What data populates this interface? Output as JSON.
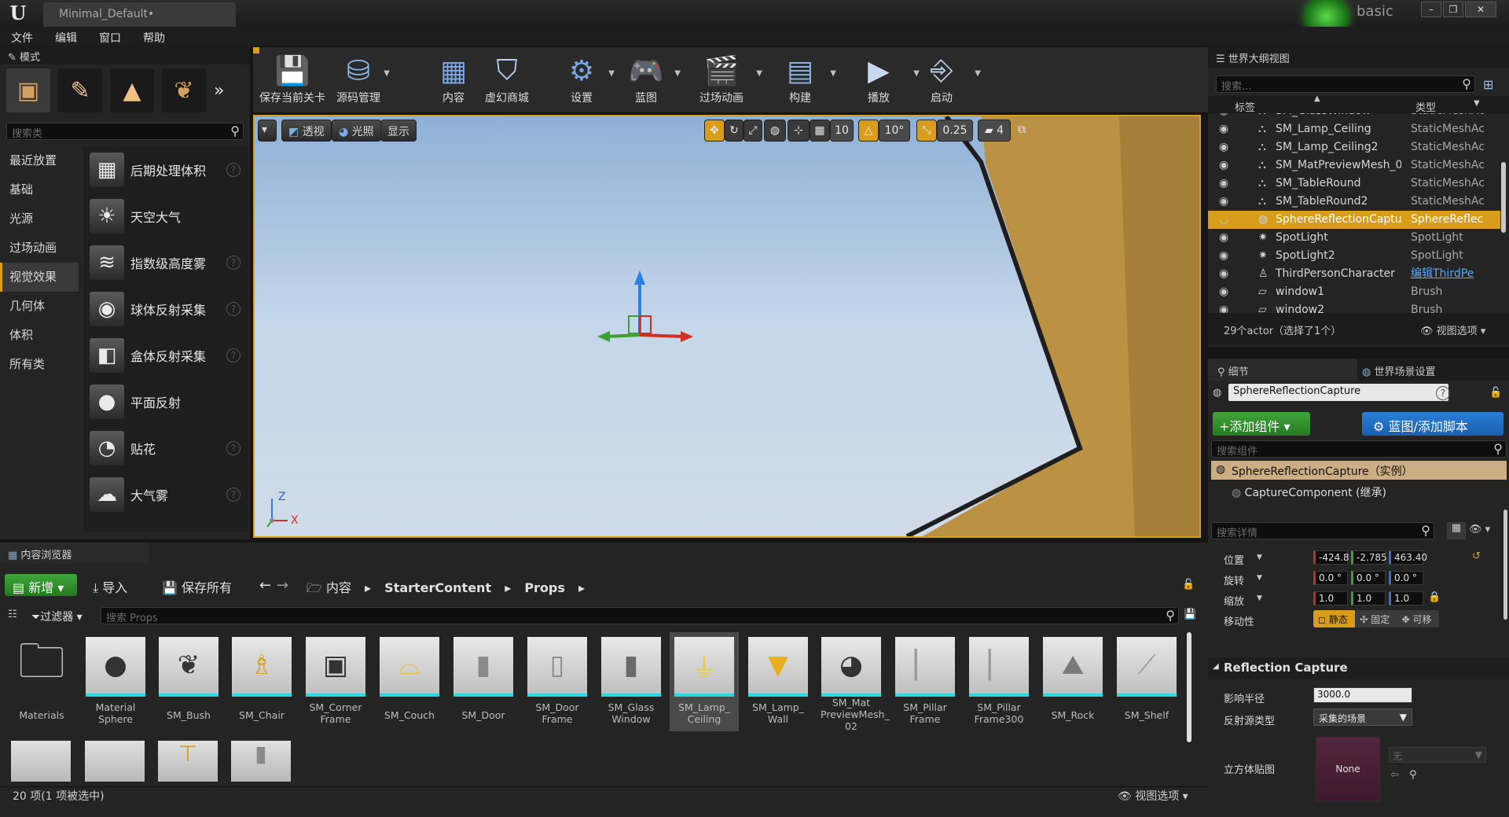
{
  "app": {
    "tab_title": "Minimal_Default•",
    "profile_name": "basic",
    "window_buttons": [
      "–",
      "❐",
      "✕"
    ]
  },
  "menu": [
    "文件",
    "编辑",
    "窗口",
    "帮助"
  ],
  "modes": {
    "tab_label": "模式",
    "search_placeholder": "搜索类",
    "categories": [
      "最近放置",
      "基础",
      "光源",
      "过场动画",
      "视觉效果",
      "几何体",
      "体积",
      "所有类"
    ],
    "active_category": "视觉效果",
    "items": [
      {
        "label": "后期处理体积",
        "icon": "post-process-icon",
        "help": true
      },
      {
        "label": "天空大气",
        "icon": "sky-atmosphere-icon",
        "help": false
      },
      {
        "label": "指数级高度雾",
        "icon": "height-fog-icon",
        "help": true
      },
      {
        "label": "球体反射采集",
        "icon": "sphere-reflection-icon",
        "help": true
      },
      {
        "label": "盒体反射采集",
        "icon": "box-reflection-icon",
        "help": true
      },
      {
        "label": "平面反射",
        "icon": "planar-reflection-icon",
        "help": false
      },
      {
        "label": "贴花",
        "icon": "decal-icon",
        "help": true
      },
      {
        "label": "大气雾",
        "icon": "atmospheric-fog-icon",
        "help": true
      }
    ]
  },
  "toolbar": {
    "save": "保存当前关卡",
    "source_control": "源码管理",
    "content": "内容",
    "marketplace": "虚幻商城",
    "settings": "设置",
    "blueprints": "蓝图",
    "cinematics": "过场动画",
    "build": "构建",
    "play": "播放",
    "launch": "启动"
  },
  "viewport": {
    "perspective": "透视",
    "lit": "光照",
    "show": "显示",
    "grid_snap": "10",
    "rotation_snap": "10°",
    "scale_snap": "0.25",
    "camera_speed": "4",
    "axis_z": "Z",
    "axis_x": "X",
    "sky_color": "#b7cde6",
    "wall_color": "#c8a052"
  },
  "outliner": {
    "tab_label": "世界大纲视图",
    "search_placeholder": "搜索...",
    "col_label": "标签",
    "col_type": "类型",
    "rows": [
      {
        "name": "SM_GlassWindow",
        "type": "StaticMeshAc"
      },
      {
        "name": "SM_Lamp_Ceiling",
        "type": "StaticMeshAc"
      },
      {
        "name": "SM_Lamp_Ceiling2",
        "type": "StaticMeshAc"
      },
      {
        "name": "SM_MatPreviewMesh_0",
        "type": "StaticMeshAc"
      },
      {
        "name": "SM_TableRound",
        "type": "StaticMeshAc"
      },
      {
        "name": "SM_TableRound2",
        "type": "StaticMeshAc"
      },
      {
        "name": "SphereReflectionCapture",
        "type": "SphereReflec"
      },
      {
        "name": "SpotLight",
        "type": "SpotLight"
      },
      {
        "name": "SpotLight2",
        "type": "SpotLight"
      },
      {
        "name": "ThirdPersonCharacter",
        "type": "编辑ThirdPe"
      },
      {
        "name": "window1",
        "type": "Brush"
      },
      {
        "name": "window2",
        "type": "Brush"
      }
    ],
    "selected_index": 6,
    "status": "29个actor（选择了1个）",
    "view_options": "视图选项"
  },
  "details": {
    "tab_details": "细节",
    "tab_world": "世界场景设置",
    "actor_name": "SphereReflectionCapture",
    "add_component": "+添加组件",
    "blueprint_script": "蓝图/添加脚本",
    "search_components": "搜索组件",
    "instance_label": "SphereReflectionCapture（实例）",
    "component_label": "CaptureComponent (继承)",
    "search_details": "搜索详情",
    "location_label": "位置",
    "location": [
      "-424.8",
      "-2.785",
      "463.40"
    ],
    "rotation_label": "旋转",
    "rotation": [
      "0.0 °",
      "0.0 °",
      "0.0 °"
    ],
    "scale_label": "缩放",
    "scale": [
      "1.0",
      "1.0",
      "1.0"
    ],
    "mobility_label": "移动性",
    "mobility": [
      "静态",
      "固定",
      "可移"
    ],
    "section_title": "Reflection Capture",
    "radius_label": "影响半径",
    "radius_value": "3000.0",
    "source_type_label": "反射源类型",
    "source_type_value": "采集的场景",
    "cubemap_label": "立方体贴图",
    "cubemap_value": "None",
    "cubemap_none": "无"
  },
  "content_browser": {
    "tab_label": "内容浏览器",
    "new_label": "新增",
    "import_label": "导入",
    "save_all_label": "保存所有",
    "path": [
      "内容",
      "StarterContent",
      "Props"
    ],
    "filters_label": "过滤器",
    "search_placeholder": "搜索 Props",
    "status": "20 项(1 项被选中)",
    "view_options": "视图选项",
    "assets": [
      {
        "line1": "Materials",
        "line2": "",
        "line3": "",
        "icon": "folder-icon",
        "kind": "folder"
      },
      {
        "line1": "Material",
        "line2": "Sphere",
        "line3": "",
        "icon": "sphere-icon"
      },
      {
        "line1": "SM_Bush",
        "line2": "",
        "line3": "",
        "icon": "bush-icon"
      },
      {
        "line1": "SM_Chair",
        "line2": "",
        "line3": "",
        "icon": "chair-icon"
      },
      {
        "line1": "SM_Corner",
        "line2": "Frame",
        "line3": "",
        "icon": "frame-icon"
      },
      {
        "line1": "SM_Couch",
        "line2": "",
        "line3": "",
        "icon": "couch-icon"
      },
      {
        "line1": "SM_Door",
        "line2": "",
        "line3": "",
        "icon": "door-icon"
      },
      {
        "line1": "SM_Door",
        "line2": "Frame",
        "line3": "",
        "icon": "door-frame-icon"
      },
      {
        "line1": "SM_Glass",
        "line2": "Window",
        "line3": "",
        "icon": "window-icon"
      },
      {
        "line1": "SM_Lamp_",
        "line2": "Ceiling",
        "line3": "",
        "icon": "lamp-icon",
        "selected": true
      },
      {
        "line1": "SM_Lamp_",
        "line2": "Wall",
        "line3": "",
        "icon": "wall-lamp-icon"
      },
      {
        "line1": "SM_Mat",
        "line2": "PreviewMesh_",
        "line3": "02",
        "icon": "preview-mesh-icon"
      },
      {
        "line1": "SM_Pillar",
        "line2": "Frame",
        "line3": "",
        "icon": "pillar-icon"
      },
      {
        "line1": "SM_Pillar",
        "line2": "Frame300",
        "line3": "",
        "icon": "pillar-icon"
      },
      {
        "line1": "SM_Rock",
        "line2": "",
        "line3": "",
        "icon": "rock-icon"
      },
      {
        "line1": "SM_Shelf",
        "line2": "",
        "line3": "",
        "icon": "shelf-icon"
      }
    ]
  }
}
